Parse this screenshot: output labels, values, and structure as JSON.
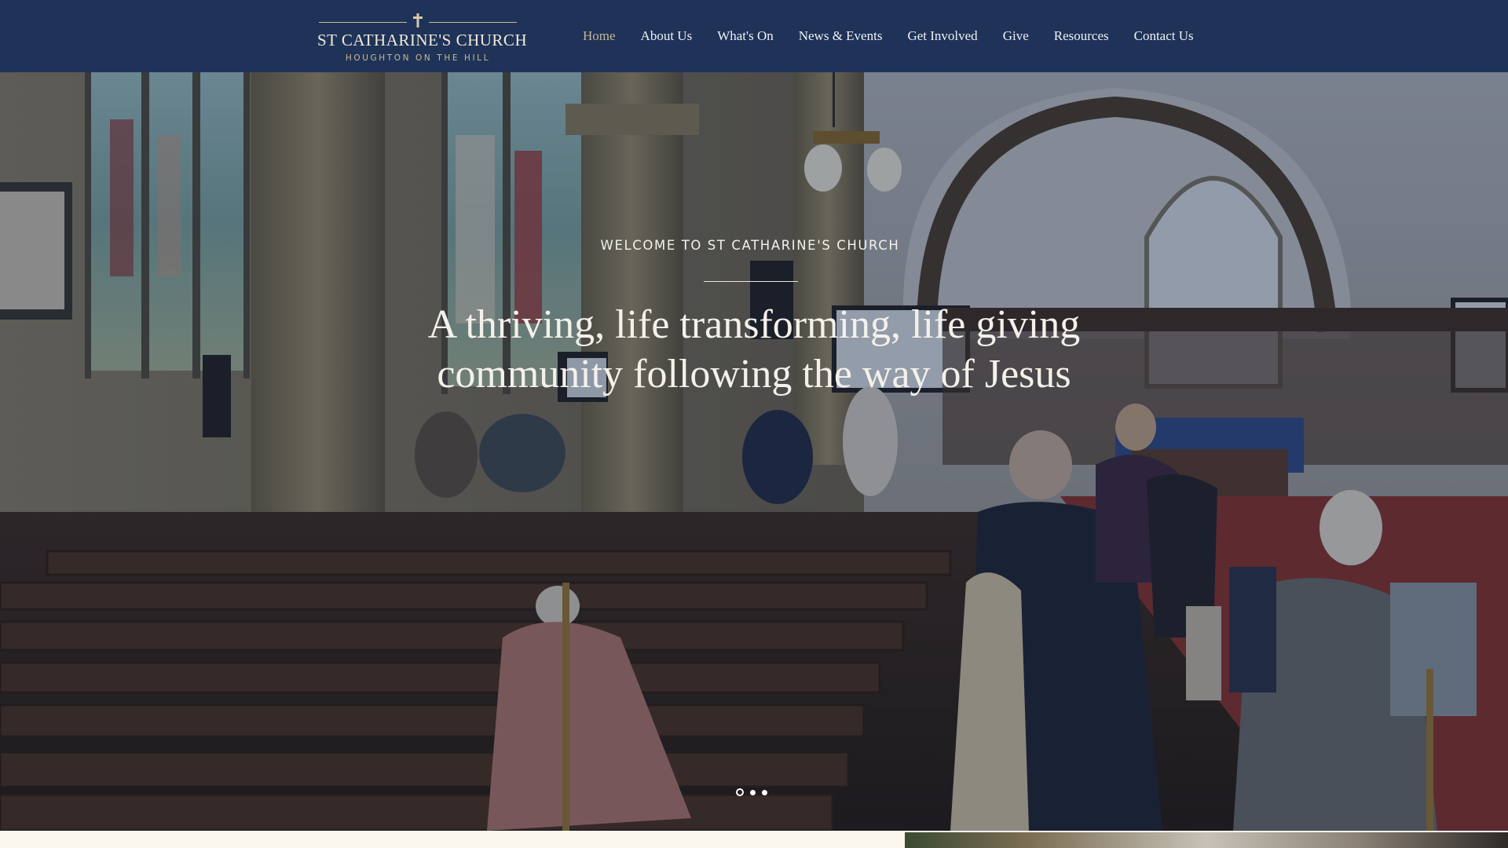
{
  "header": {
    "logo": {
      "title": "ST CATHARINE'S CHURCH",
      "subtitle": "HOUGHTON ON THE HILL",
      "icon": "cross-icon"
    },
    "nav": [
      {
        "label": "Home",
        "active": true
      },
      {
        "label": "About Us",
        "active": false
      },
      {
        "label": "What's On",
        "active": false
      },
      {
        "label": "News & Events",
        "active": false
      },
      {
        "label": "Get Involved",
        "active": false
      },
      {
        "label": "Give",
        "active": false
      },
      {
        "label": "Resources",
        "active": false
      },
      {
        "label": "Contact Us",
        "active": false
      }
    ]
  },
  "hero": {
    "eyebrow": "WELCOME TO ST CATHARINE'S CHURCH",
    "heading_line1": "A thriving, life transforming, life giving",
    "heading_line2": "community following the way of Jesus",
    "slides": 3,
    "active_slide": 1
  },
  "colors": {
    "header_bg": "#1f3358",
    "nav_active": "#c6b48f",
    "page_bg": "#fbf7ee"
  }
}
